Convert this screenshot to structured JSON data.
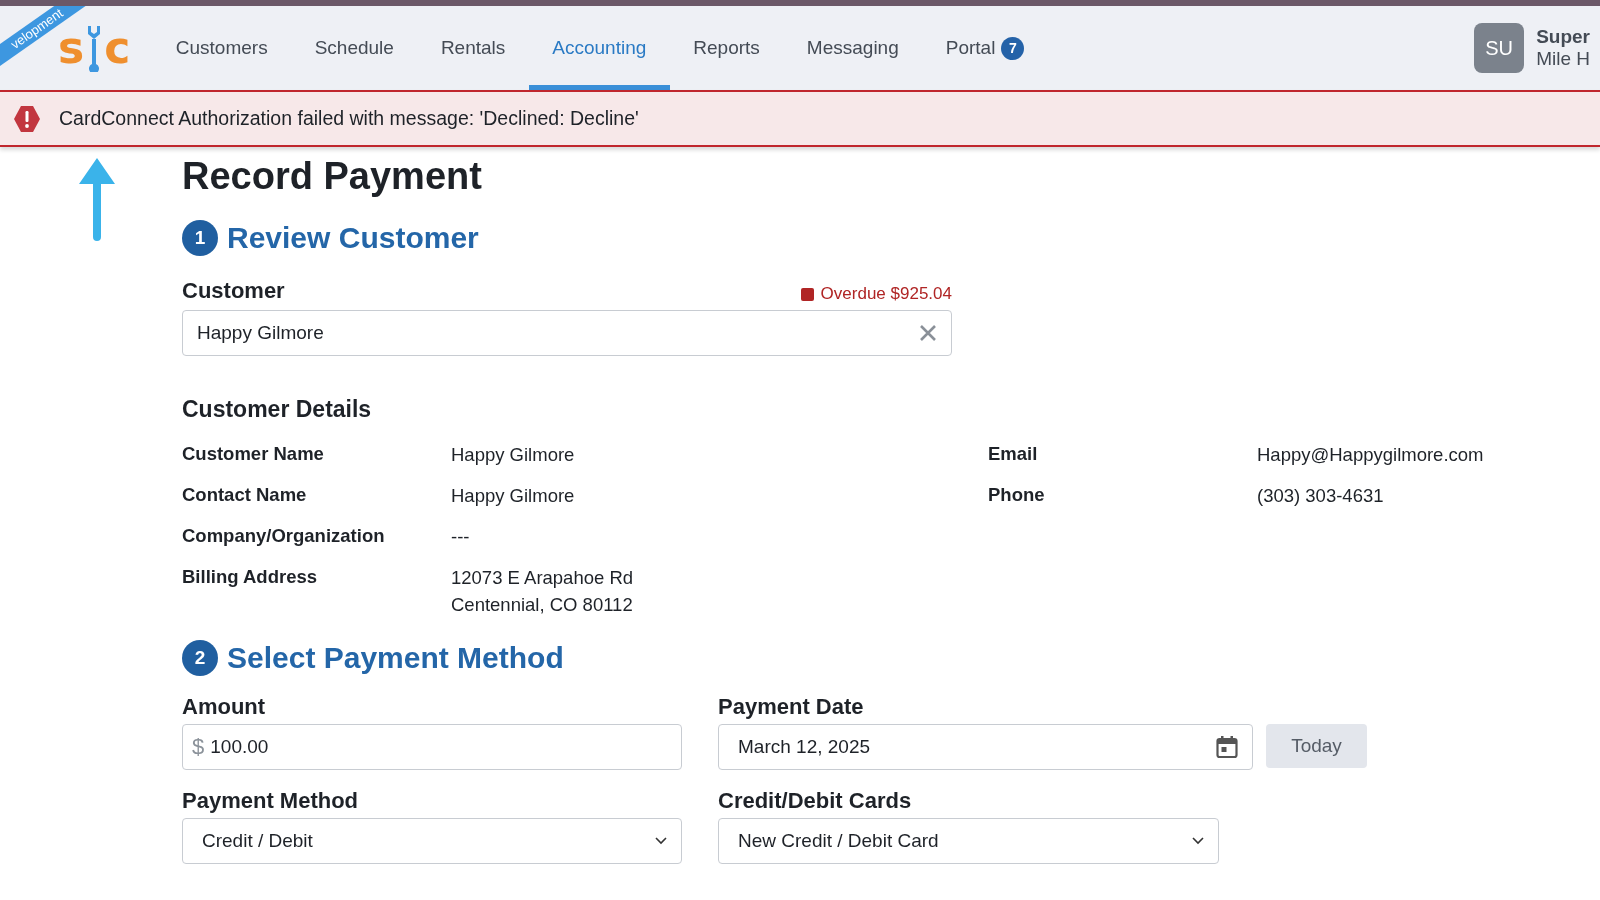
{
  "ribbon": "velopment",
  "logo": {
    "left": "s",
    "right": "c"
  },
  "nav": [
    {
      "label": "Customers",
      "selected": false
    },
    {
      "label": "Schedule",
      "selected": false
    },
    {
      "label": "Rentals",
      "selected": false
    },
    {
      "label": "Accounting",
      "selected": true
    },
    {
      "label": "Reports",
      "selected": false
    },
    {
      "label": "Messaging",
      "selected": false
    },
    {
      "label": "Portal",
      "selected": false,
      "badge": "7"
    }
  ],
  "user": {
    "initials": "SU",
    "name": "Super",
    "org": "Mile H"
  },
  "alert": {
    "message": "CardConnect Authorization failed with message: 'Declined: Decline'"
  },
  "page_title": "Record Payment",
  "review": {
    "number": "1",
    "title": "Review Customer",
    "customer": {
      "label": "Customer",
      "overdue": "Overdue $925.04",
      "value": "Happy Gilmore"
    },
    "details_title": "Customer Details",
    "details_left": [
      {
        "label": "Customer Name",
        "lines": [
          "Happy Gilmore"
        ]
      },
      {
        "label": "Contact Name",
        "lines": [
          "Happy Gilmore"
        ]
      },
      {
        "label": "Company/Organization",
        "lines": [
          "---"
        ]
      },
      {
        "label": "Billing Address",
        "lines": [
          "12073 E Arapahoe Rd",
          "Centennial, CO 80112"
        ]
      }
    ],
    "details_right": [
      {
        "label": "Email",
        "lines": [
          "Happy@Happygilmore.com"
        ]
      },
      {
        "label": "Phone",
        "lines": [
          "(303) 303-4631"
        ]
      }
    ]
  },
  "payment": {
    "number": "2",
    "title": "Select Payment Method",
    "amount": {
      "label": "Amount",
      "currency": "$",
      "value": "100.00"
    },
    "payment_date": {
      "label": "Payment Date",
      "value": "March 12, 2025",
      "button": "Today"
    },
    "payment_method": {
      "label": "Payment Method",
      "value": "Credit / Debit"
    },
    "cards": {
      "label": "Credit/Debit Cards",
      "value": "New Credit / Debit Card"
    }
  }
}
